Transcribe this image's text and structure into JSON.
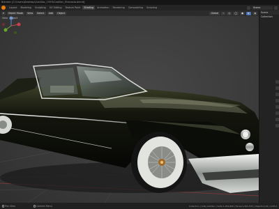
{
  "window": {
    "title": "Blender [C:\\Users\\Desktop\\Cadillac_1959\\Cadillac_Eldorado.blend]"
  },
  "menubar": {
    "workspaces": [
      "Layout",
      "Modeling",
      "Sculpting",
      "UV Editing",
      "Texture Paint",
      "Shading",
      "Animation",
      "Rendering",
      "Compositing",
      "Scripting"
    ],
    "active_workspace": "Shading",
    "scene": "Scene"
  },
  "viewport_header": {
    "mode": "Object Mode",
    "menus": [
      "View",
      "Select",
      "Add",
      "Object"
    ],
    "transform": "Global"
  },
  "viewport_sub": {
    "items": [
      "View",
      "Object"
    ]
  },
  "outliner": {
    "title": "Scene Collection"
  },
  "statusbar": {
    "items": [
      "Pan View",
      "Context Menu"
    ],
    "stats": "Collection | CAR_Cadillac | Verts:1,254,806 | Faces:1,201,533 | Objects:1/34 | 2.83.0"
  },
  "colors": {
    "accent": "#4772b3",
    "car_body": "#0b0d09",
    "chrome": "#c9cdca",
    "whitewall": "#e2e4e0"
  }
}
